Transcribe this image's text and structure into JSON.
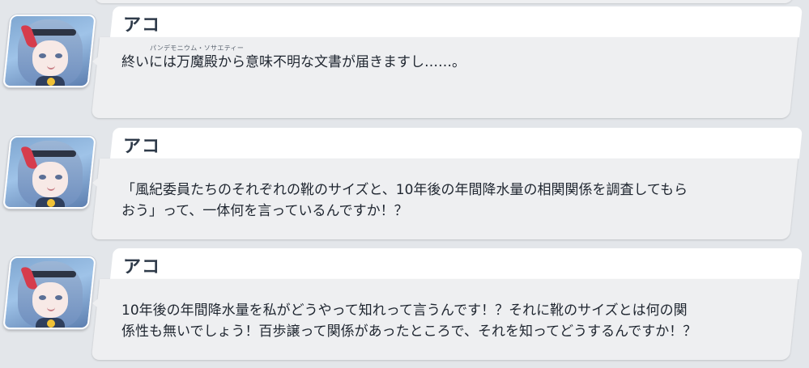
{
  "messages": [
    {
      "speaker": "アコ",
      "ruby": "パンデモニウム・ソサエティー",
      "text": "終いには万魔殿から意味不明な文書が届きますし……。"
    },
    {
      "speaker": "アコ",
      "line1": "「風紀委員たちのそれぞれの靴のサイズと、10年後の年間降水量の相関関係を調査してもら",
      "line2": "おう」って、一体何を言っているんですか！？"
    },
    {
      "speaker": "アコ",
      "line1": "10年後の年間降水量を私がどうやって知れって言うんです！？それに靴のサイズとは何の関",
      "line2": "係性も無いでしょう！百歩譲って関係があったところで、それを知ってどうするんですか！？"
    }
  ]
}
